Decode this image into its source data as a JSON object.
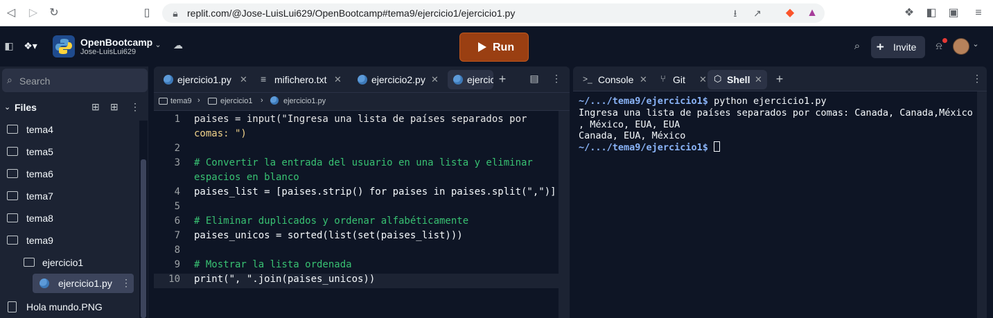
{
  "browser": {
    "url": "replit.com/@Jose-LuisLui629/OpenBootcamp#tema9/ejercicio1/ejercicio1.py"
  },
  "header": {
    "repl_name": "OpenBootcamp",
    "owner": "Jose-LuisLui629",
    "run_label": "Run",
    "invite_label": "Invite"
  },
  "sidebar": {
    "search_placeholder": "Search",
    "files_label": "Files",
    "items": [
      {
        "label": "tema4"
      },
      {
        "label": "tema5"
      },
      {
        "label": "tema6"
      },
      {
        "label": "tema7"
      },
      {
        "label": "tema8"
      },
      {
        "label": "tema9"
      },
      {
        "label": "ejercicio1"
      },
      {
        "label": "ejercicio1.py"
      },
      {
        "label": "Hola mundo.PNG"
      }
    ]
  },
  "editor": {
    "tabs": [
      {
        "label": "ejercicio1.py"
      },
      {
        "label": "mifichero.txt"
      },
      {
        "label": "ejercicio2.py"
      },
      {
        "label": "ejercic"
      }
    ],
    "breadcrumb": [
      "tema9",
      "ejercicio1",
      "ejercicio1.py"
    ],
    "line_numbers": [
      "1",
      "2",
      "3",
      "4",
      "5",
      "6",
      "7",
      "8",
      "9",
      "10"
    ],
    "code_lines": [
      "paises = input(\"Ingresa una lista de países separados por",
      "comas: \")",
      "",
      "# Convertir la entrada del usuario en una lista y eliminar",
      "espacios en blanco",
      "paises_list = [paises.strip() for paises in paises.split(\",\")]",
      "",
      "# Eliminar duplicados y ordenar alfabéticamente",
      "paises_unicos = sorted(list(set(paises_list)))",
      "",
      "# Mostrar la lista ordenada",
      "print(\", \".join(paises_unicos))"
    ]
  },
  "shell": {
    "tabs": [
      {
        "label": "Console"
      },
      {
        "label": "Git"
      },
      {
        "label": "Shell"
      }
    ],
    "prompt": "~/.../tema9/ejercicio1$",
    "command": " python ejercicio1.py",
    "output": [
      "Ingresa una lista de países separados por comas: Canada, Canada,México",
      ", México, EUA, EUA",
      "Canada, EUA, México"
    ]
  },
  "colors": {
    "run_button": "#9a3f12",
    "background": "#0e1525",
    "panel": "#1c2333",
    "comment": "#38c172"
  }
}
